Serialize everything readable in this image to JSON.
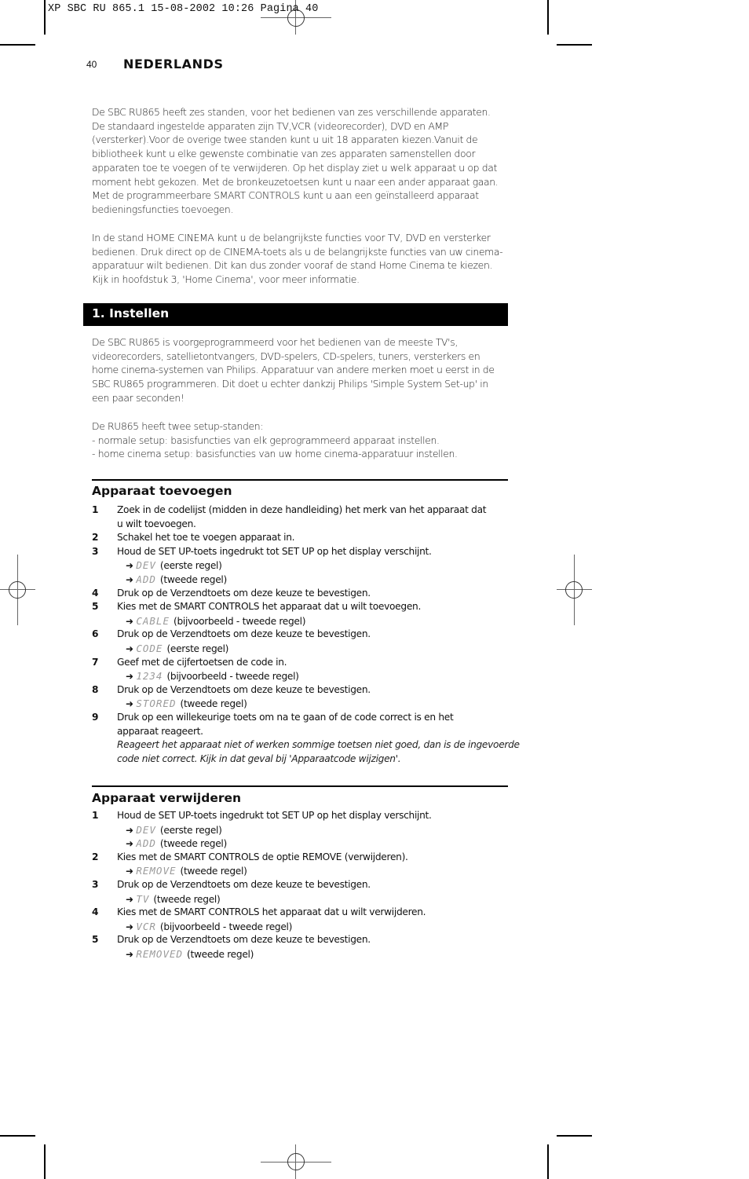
{
  "slug": "XP SBC RU 865.1 15-08-2002 10:26 Pagina 40",
  "header": {
    "page_number": "40",
    "language": "NEDERLANDS"
  },
  "intro": {
    "paragraph1": [
      "De SBC RU865 heeft zes standen, voor het bedienen van zes verschillende apparaten.",
      "De standaard ingestelde apparaten zijn TV,VCR (videorecorder), DVD en AMP",
      "(versterker).Voor de overige twee standen kunt u uit 18 apparaten kiezen.Vanuit de",
      "bibliotheek kunt u elke gewenste combinatie van zes apparaten samenstellen door",
      "apparaten toe te voegen of te verwijderen. Op het display ziet u welk apparaat u op dat",
      "moment hebt gekozen. Met de bronkeuzetoetsen kunt u naar een ander apparaat gaan.",
      "Met de programmeerbare SMART CONTROLS kunt u aan een geïnstalleerd apparaat",
      "bedieningsfuncties toevoegen."
    ],
    "paragraph2": [
      "In de stand HOME CINEMA kunt u de belangrijkste functies voor TV, DVD en versterker",
      "bedienen. Druk direct op de CINEMA-toets als u de belangrijkste functies van uw cinema-",
      "apparatuur wilt bedienen. Dit kan dus zonder vooraf de stand Home Cinema te kiezen.",
      "Kijk in hoofdstuk 3, 'Home Cinema', voor meer informatie."
    ]
  },
  "section1": {
    "title": "1. Instellen",
    "paragraph1": [
      "De SBC RU865 is voorgeprogrammeerd voor het bedienen van de meeste TV's,",
      "videorecorders, satellietontvangers, DVD-spelers, CD-spelers, tuners, versterkers en",
      "home cinema-systemen van Philips. Apparatuur van andere merken moet u eerst in de",
      "SBC RU865 programmeren. Dit doet u echter dankzij Philips 'Simple System Set-up' in",
      "een paar seconden!"
    ],
    "paragraph2": [
      "De RU865 heeft twee setup-standen:",
      "- normale setup: basisfuncties van elk geprogrammeerd apparaat instellen.",
      "- home cinema setup: basisfuncties van uw home cinema-apparatuur instellen."
    ]
  },
  "add_device": {
    "title": "Apparaat toevoegen",
    "lines": [
      {
        "num": "1",
        "text": "Zoek in de codelijst (midden in deze handleiding) het merk van het apparaat dat"
      },
      {
        "text": "u wilt toevoegen."
      },
      {
        "num": "2",
        "text": "Schakel het toe te voegen apparaat in."
      },
      {
        "num": "3",
        "text": "Houd de SET UP-toets ingedrukt tot SET UP op het display verschijnt."
      },
      {
        "arrow": "➜",
        "lcd": "DEV",
        "text": "(eerste regel)"
      },
      {
        "arrow": "➜",
        "lcd": "ADD",
        "text": "(tweede regel)"
      },
      {
        "num": "4",
        "text": "Druk op de Verzendtoets om deze keuze te bevestigen."
      },
      {
        "num": "5",
        "text": "Kies met de SMART CONTROLS het apparaat dat u wilt toevoegen."
      },
      {
        "arrow": "➜",
        "lcd": "CABLE",
        "text": "(bijvoorbeeld - tweede regel)"
      },
      {
        "num": "6",
        "text": "Druk op de Verzendtoets om deze keuze te bevestigen."
      },
      {
        "arrow": "➜",
        "lcd": "CODE",
        "text": "(eerste regel)"
      },
      {
        "num": "7",
        "text": "Geef met de cijfertoetsen de code in."
      },
      {
        "arrow": "➜",
        "lcd": "1234",
        "text": "(bijvoorbeeld - tweede regel)"
      },
      {
        "num": "8",
        "text": "Druk op de Verzendtoets om deze keuze te bevestigen."
      },
      {
        "arrow": "➜",
        "lcd": "STORED",
        "text": "(tweede regel)"
      },
      {
        "num": "9",
        "text": "Druk op een willekeurige toets om na te gaan of de code correct is en het"
      },
      {
        "text": "apparaat reageert."
      },
      {
        "note": "Reageert het apparaat niet of werken sommige toetsen niet goed, dan is de ingevoerde"
      },
      {
        "note": "code niet correct. Kijk in dat geval bij 'Apparaatcode wijzigen'."
      }
    ]
  },
  "remove_device": {
    "title": "Apparaat verwijderen",
    "lines": [
      {
        "num": "1",
        "text": "Houd de SET UP-toets ingedrukt tot SET UP op het display verschijnt."
      },
      {
        "arrow": "➜",
        "lcd": "DEV",
        "text": "(eerste regel)"
      },
      {
        "arrow": "➜",
        "lcd": "ADD",
        "text": "(tweede regel)"
      },
      {
        "num": "2",
        "text": "Kies met de SMART CONTROLS de optie REMOVE (verwijderen)."
      },
      {
        "arrow": "➜",
        "lcd": "REMOVE",
        "text": "(tweede regel)"
      },
      {
        "num": "3",
        "text": "Druk op de Verzendtoets om deze keuze te bevestigen."
      },
      {
        "arrow": "➜",
        "lcd": "TV",
        "text": "(tweede regel)"
      },
      {
        "num": "4",
        "text": "Kies met de SMART CONTROLS het apparaat dat u wilt verwijderen."
      },
      {
        "arrow": "➜",
        "lcd": "VCR",
        "text": "(bijvoorbeeld - tweede regel)"
      },
      {
        "num": "5",
        "text": "Druk op de Verzendtoets om deze keuze te bevestigen."
      },
      {
        "arrow": "➜",
        "lcd": "REMOVED",
        "text": "(tweede regel)"
      }
    ]
  }
}
